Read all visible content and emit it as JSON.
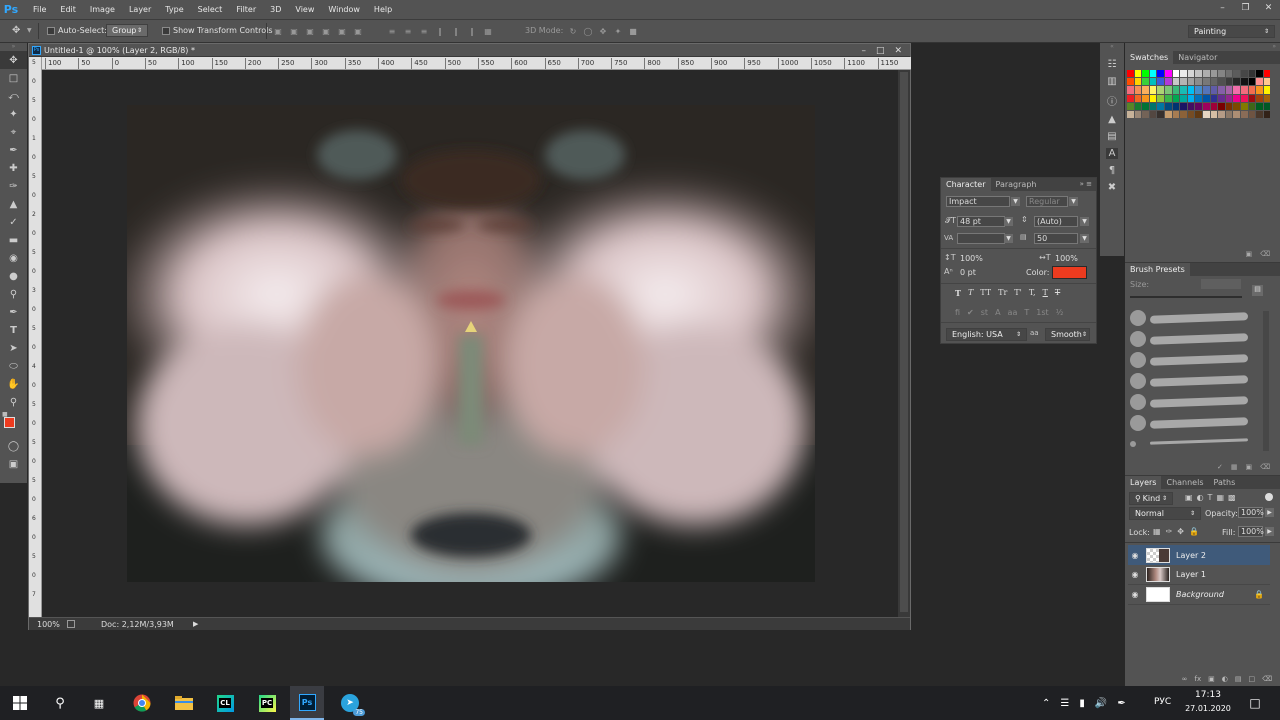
{
  "app": {
    "logo": "Ps"
  },
  "menu": [
    "File",
    "Edit",
    "Image",
    "Layer",
    "Type",
    "Select",
    "Filter",
    "3D",
    "View",
    "Window",
    "Help"
  ],
  "options": {
    "auto_select_label": "Auto-Select:",
    "auto_select_value": "Group",
    "transform_label": "Show Transform Controls",
    "mode_3d_label": "3D Mode:",
    "workspace": "Painting"
  },
  "document": {
    "tab_title": "Untitled-1 @ 100% (Layer 2, RGB/8) *",
    "ruler_h": [
      "100",
      "50",
      "0",
      "50",
      "100",
      "150",
      "200",
      "250",
      "300",
      "350",
      "400",
      "450",
      "500",
      "550",
      "600",
      "650",
      "700",
      "750",
      "800",
      "850",
      "900",
      "950",
      "1000",
      "1050",
      "1100",
      "1150"
    ],
    "ruler_v": [
      "5",
      "0",
      "5",
      "0",
      "1",
      "0",
      "5",
      "0",
      "2",
      "0",
      "5",
      "0",
      "3",
      "0",
      "5",
      "0",
      "4",
      "0",
      "5",
      "0",
      "5",
      "0",
      "5",
      "0",
      "6",
      "0",
      "5",
      "0",
      "7"
    ],
    "zoom": "100%",
    "doc_info": "Doc: 2,12M/3,93M"
  },
  "colors": {
    "foreground": "#ed3b1f",
    "background": "#000000",
    "accent": "#31a8ff"
  },
  "swatches_panel": {
    "tabs": [
      "Swatches",
      "Navigator"
    ]
  },
  "character": {
    "tabs": [
      "Character",
      "Paragraph"
    ],
    "font_family": "Impact",
    "font_style": "Regular",
    "font_size": "48 pt",
    "leading": "(Auto)",
    "kerning": "",
    "tracking": "50",
    "vscale": "100%",
    "hscale": "100%",
    "baseline": "0 pt",
    "color_label": "Color:",
    "color": "#ed3b1f",
    "language": "English: USA",
    "antialias_icon": "aa",
    "antialias": "Smooth",
    "type_buttons": [
      "T",
      "T",
      "TT",
      "Tr",
      "T'",
      "T,",
      "T",
      "T"
    ]
  },
  "brush_presets": {
    "title": "Brush Presets",
    "size_label": "Size:"
  },
  "layers": {
    "tabs": [
      "Layers",
      "Channels",
      "Paths"
    ],
    "kind": "Kind",
    "blend": "Normal",
    "opacity_label": "Opacity:",
    "opacity": "100%",
    "lock_label": "Lock:",
    "fill_label": "Fill:",
    "fill": "100%",
    "items": [
      {
        "name": "Layer 2",
        "selected": true
      },
      {
        "name": "Layer 1",
        "selected": false
      },
      {
        "name": "Background",
        "selected": false
      }
    ]
  },
  "taskbar": {
    "language": "РУС",
    "time": "17:13",
    "date": "27.01.2020",
    "telegram_badge": "75"
  }
}
